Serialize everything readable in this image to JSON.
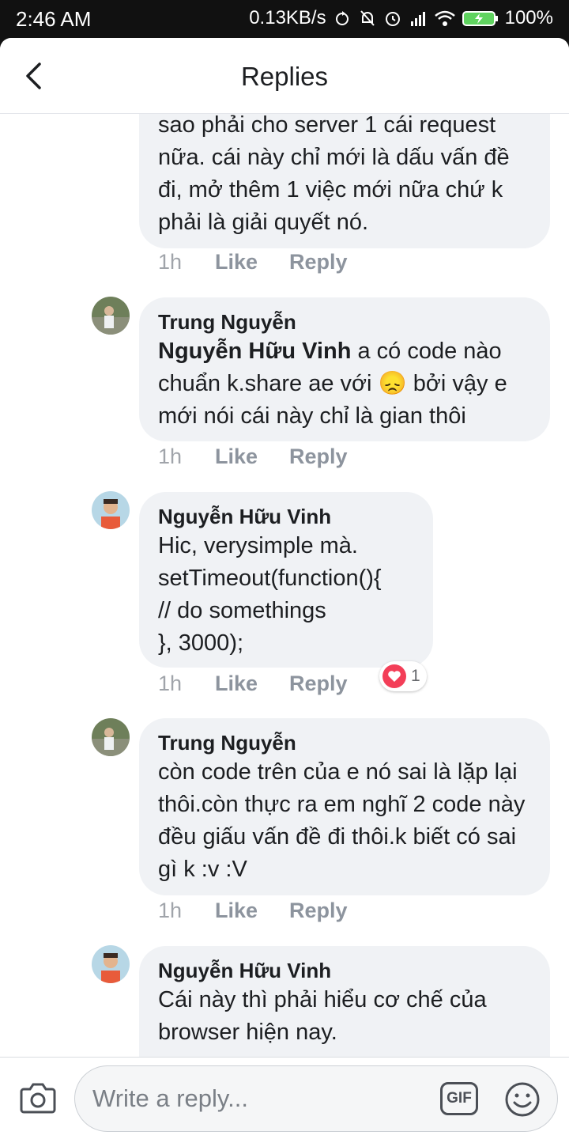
{
  "status_bar": {
    "time": "2:46 AM",
    "net_speed": "0.13KB/s",
    "battery": "100%"
  },
  "header": {
    "title": "Replies"
  },
  "comments": [
    {
      "partial_text": "sao phải cho server 1 cái request nữa. cái này chỉ mới là dấu vấn đề đi, mở thêm 1 việc mới nữa chứ k phải là giải quyết nó.",
      "time": "1h",
      "like": "Like",
      "reply": "Reply"
    },
    {
      "author": "Trung Nguyễn",
      "mention": "Nguyễn Hữu Vinh",
      "text_a": "a có code nào chuẩn k.share ae với",
      "emoji": "😞",
      "text_b": "bởi vậy e mới nói cái này chỉ là gian thôi",
      "time": "1h",
      "like": "Like",
      "reply": "Reply"
    },
    {
      "author": "Nguyễn Hữu Vinh",
      "lines": [
        "Hic, verysimple mà.",
        "setTimeout(function(){",
        "// do somethings",
        "}, 3000);"
      ],
      "time": "1h",
      "like": "Like",
      "reply": "Reply",
      "reaction_count": "1"
    },
    {
      "author": "Trung Nguyễn",
      "text": "còn code trên của e nó sai là lặp lại thôi.còn thực ra em nghĩ 2 code này đều giấu vấn đề đi thôi.k biết có sai gì k :v :V",
      "time": "1h",
      "like": "Like",
      "reply": "Reply"
    },
    {
      "author": "Nguyễn Hữu Vinh",
      "text": "Cái này thì phải hiểu cơ chế của browser hiện nay."
    }
  ],
  "composer": {
    "placeholder": "Write a reply...",
    "gif_label": "GIF"
  },
  "icons": {
    "back": "chevron-left-icon",
    "camera": "camera-icon",
    "emoji": "smiley-icon",
    "reaction": "heart-icon"
  },
  "colors": {
    "bubble": "#f0f2f5",
    "reaction_heart": "#f33e58",
    "meta_text": "#8d949e"
  }
}
